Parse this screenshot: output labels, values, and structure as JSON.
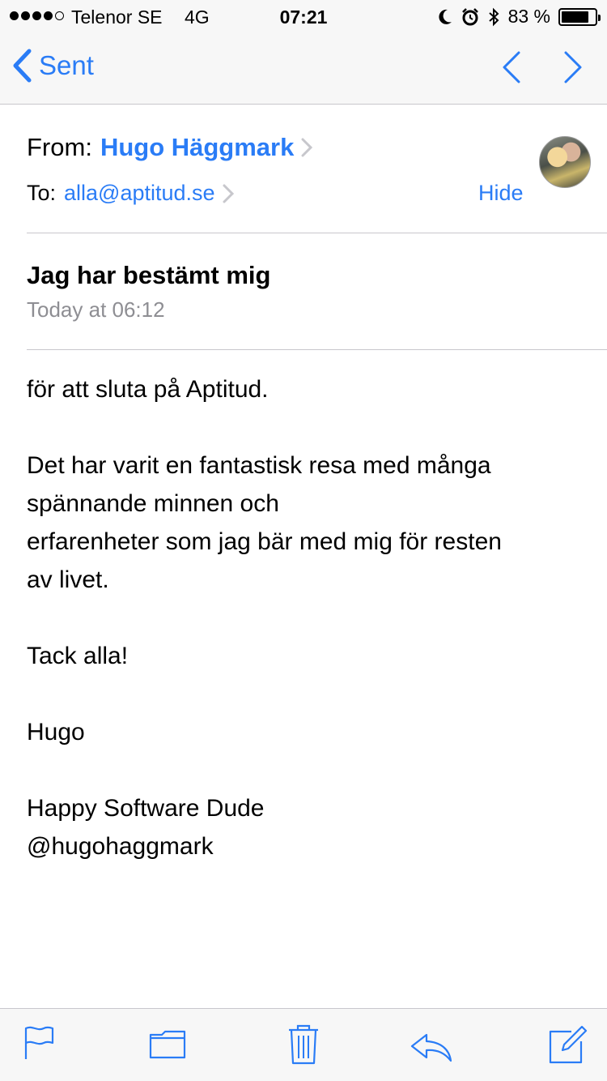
{
  "status_bar": {
    "carrier": "Telenor SE",
    "network": "4G",
    "time": "07:21",
    "battery_percent": "83 %",
    "battery_level": 0.83
  },
  "nav": {
    "back_label": "Sent"
  },
  "header": {
    "from_label": "From:",
    "sender": "Hugo Häggmark",
    "to_label": "To:",
    "recipient": "alla@aptitud.se",
    "hide_label": "Hide"
  },
  "email": {
    "subject": "Jag har bestämt mig",
    "date": "Today at 06:12",
    "body": {
      "p1": "för att sluta på Aptitud.",
      "p2_line1": "Det har varit en fantastisk resa med många",
      "p2_line2": "spännande minnen och",
      "p2_line3": "erfarenheter som jag bär med mig för resten",
      "p2_line4": "av livet.",
      "p3": "Tack alla!",
      "p4": "Hugo",
      "p5_line1": "Happy Software Dude",
      "p5_line2": "@hugohaggmark"
    }
  },
  "colors": {
    "accent": "#2a7cf6",
    "secondary_text": "#8e8e93",
    "separator": "#c8c7cc",
    "bar_background": "#f7f7f7"
  },
  "icons": [
    "moon-icon",
    "alarm-icon",
    "bluetooth-icon",
    "battery-icon",
    "back-chevron-icon",
    "up-arrow-icon",
    "down-arrow-icon",
    "flag-icon",
    "folder-icon",
    "trash-icon",
    "reply-icon",
    "compose-icon"
  ]
}
